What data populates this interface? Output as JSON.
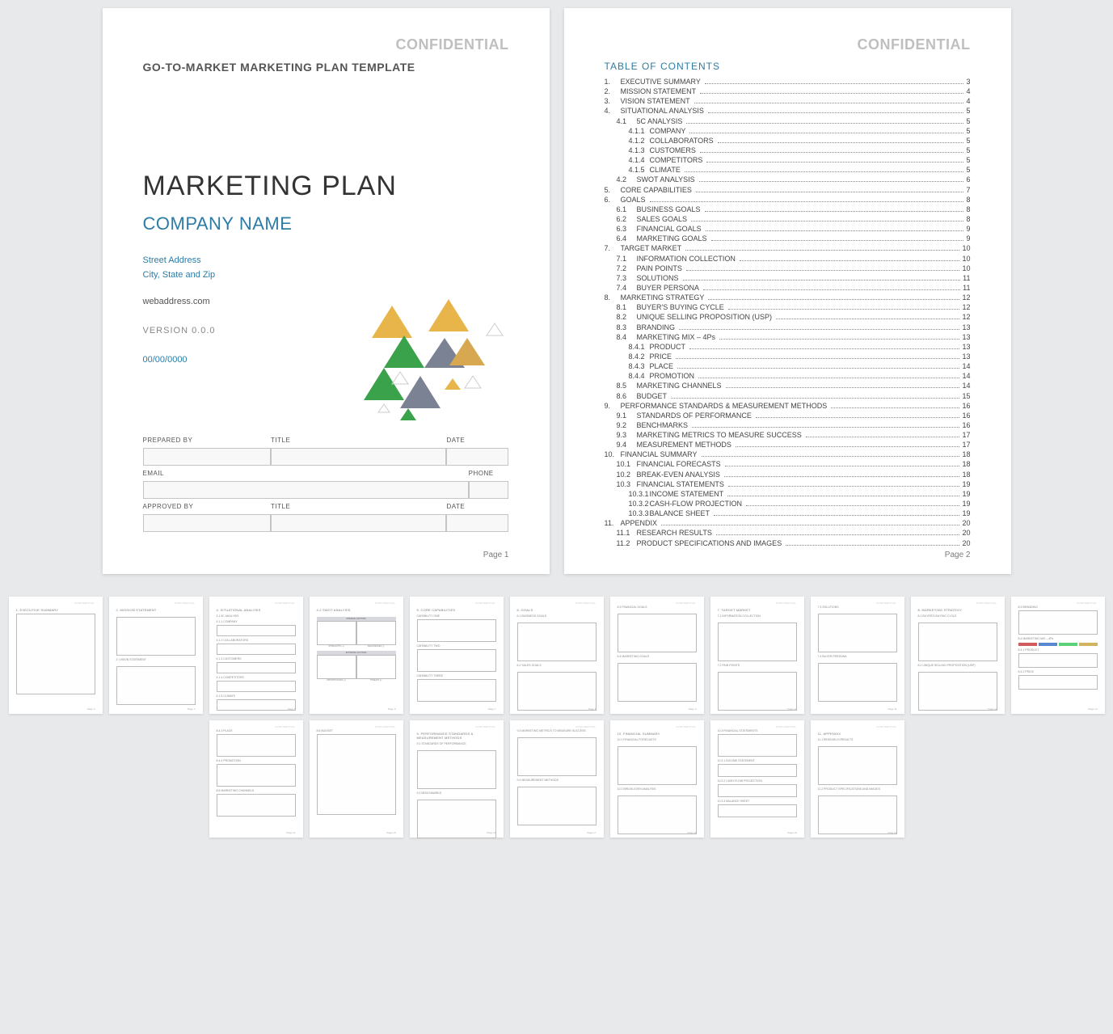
{
  "confidential": "CONFIDENTIAL",
  "cover": {
    "template_header": "GO-TO-MARKET MARKETING PLAN TEMPLATE",
    "title": "MARKETING PLAN",
    "company": "COMPANY NAME",
    "street": "Street Address",
    "citystate": "City, State and Zip",
    "web": "webaddress.com",
    "version": "VERSION 0.0.0",
    "date": "00/00/0000",
    "labels": {
      "prepared_by": "PREPARED BY",
      "title": "TITLE",
      "date": "DATE",
      "email": "EMAIL",
      "phone": "PHONE",
      "approved_by": "APPROVED BY"
    },
    "pgnum": "Page 1"
  },
  "toc": {
    "title": "TABLE OF CONTENTS",
    "pgnum": "Page 2",
    "items": [
      {
        "n": "1.",
        "t": "EXECUTIVE SUMMARY",
        "p": "3",
        "i": 1
      },
      {
        "n": "2.",
        "t": "MISSION STATEMENT",
        "p": "4",
        "i": 1
      },
      {
        "n": "3.",
        "t": "VISION STATEMENT",
        "p": "4",
        "i": 1
      },
      {
        "n": "4.",
        "t": "SITUATIONAL ANALYSIS",
        "p": "5",
        "i": 1
      },
      {
        "n": "4.1",
        "t": "5C ANALYSIS",
        "p": "5",
        "i": 2
      },
      {
        "n": "4.1.1",
        "t": "COMPANY",
        "p": "5",
        "i": 3
      },
      {
        "n": "4.1.2",
        "t": "COLLABORATORS",
        "p": "5",
        "i": 3
      },
      {
        "n": "4.1.3",
        "t": "CUSTOMERS",
        "p": "5",
        "i": 3
      },
      {
        "n": "4.1.4",
        "t": "COMPETITORS",
        "p": "5",
        "i": 3
      },
      {
        "n": "4.1.5",
        "t": "CLIMATE",
        "p": "5",
        "i": 3
      },
      {
        "n": "4.2",
        "t": "SWOT ANALYSIS",
        "p": "6",
        "i": 2
      },
      {
        "n": "5.",
        "t": "CORE CAPABILITIES",
        "p": "7",
        "i": 1
      },
      {
        "n": "6.",
        "t": "GOALS",
        "p": "8",
        "i": 1
      },
      {
        "n": "6.1",
        "t": "BUSINESS GOALS",
        "p": "8",
        "i": 2
      },
      {
        "n": "6.2",
        "t": "SALES GOALS",
        "p": "8",
        "i": 2
      },
      {
        "n": "6.3",
        "t": "FINANCIAL GOALS",
        "p": "9",
        "i": 2
      },
      {
        "n": "6.4",
        "t": "MARKETING GOALS",
        "p": "9",
        "i": 2
      },
      {
        "n": "7.",
        "t": "TARGET MARKET",
        "p": "10",
        "i": 1
      },
      {
        "n": "7.1",
        "t": "INFORMATION COLLECTION",
        "p": "10",
        "i": 2
      },
      {
        "n": "7.2",
        "t": "PAIN POINTS",
        "p": "10",
        "i": 2
      },
      {
        "n": "7.3",
        "t": "SOLUTIONS",
        "p": "11",
        "i": 2
      },
      {
        "n": "7.4",
        "t": "BUYER PERSONA",
        "p": "11",
        "i": 2
      },
      {
        "n": "8.",
        "t": "MARKETING STRATEGY",
        "p": "12",
        "i": 1
      },
      {
        "n": "8.1",
        "t": "BUYER'S BUYING CYCLE",
        "p": "12",
        "i": 2
      },
      {
        "n": "8.2",
        "t": "UNIQUE SELLING PROPOSITION (USP)",
        "p": "12",
        "i": 2
      },
      {
        "n": "8.3",
        "t": "BRANDING",
        "p": "13",
        "i": 2
      },
      {
        "n": "8.4",
        "t": "MARKETING MIX – 4Ps",
        "p": "13",
        "i": 2
      },
      {
        "n": "8.4.1",
        "t": "PRODUCT",
        "p": "13",
        "i": 3
      },
      {
        "n": "8.4.2",
        "t": "PRICE",
        "p": "13",
        "i": 3
      },
      {
        "n": "8.4.3",
        "t": "PLACE",
        "p": "14",
        "i": 3
      },
      {
        "n": "8.4.4",
        "t": "PROMOTION",
        "p": "14",
        "i": 3
      },
      {
        "n": "8.5",
        "t": "MARKETING CHANNELS",
        "p": "14",
        "i": 2
      },
      {
        "n": "8.6",
        "t": "BUDGET",
        "p": "15",
        "i": 2
      },
      {
        "n": "9.",
        "t": "PERFORMANCE STANDARDS & MEASUREMENT METHODS",
        "p": "16",
        "i": 1
      },
      {
        "n": "9.1",
        "t": "STANDARDS OF PERFORMANCE",
        "p": "16",
        "i": 2
      },
      {
        "n": "9.2",
        "t": "BENCHMARKS",
        "p": "16",
        "i": 2
      },
      {
        "n": "9.3",
        "t": "MARKETING METRICS TO MEASURE SUCCESS",
        "p": "17",
        "i": 2
      },
      {
        "n": "9.4",
        "t": "MEASUREMENT METHODS",
        "p": "17",
        "i": 2
      },
      {
        "n": "10.",
        "t": "FINANCIAL SUMMARY",
        "p": "18",
        "i": 1
      },
      {
        "n": "10.1",
        "t": "FINANCIAL FORECASTS",
        "p": "18",
        "i": 2
      },
      {
        "n": "10.2",
        "t": "BREAK-EVEN ANALYSIS",
        "p": "18",
        "i": 2
      },
      {
        "n": "10.3",
        "t": "FINANCIAL STATEMENTS",
        "p": "19",
        "i": 2
      },
      {
        "n": "10.3.1",
        "t": "INCOME STATEMENT",
        "p": "19",
        "i": 3
      },
      {
        "n": "10.3.2",
        "t": "CASH-FLOW PROJECTION",
        "p": "19",
        "i": 3
      },
      {
        "n": "10.3.3",
        "t": "BALANCE SHEET",
        "p": "19",
        "i": 3
      },
      {
        "n": "11.",
        "t": "APPENDIX",
        "p": "20",
        "i": 1
      },
      {
        "n": "11.1",
        "t": "RESEARCH RESULTS",
        "p": "20",
        "i": 2
      },
      {
        "n": "11.2",
        "t": "PRODUCT SPECIFICATIONS AND IMAGES",
        "p": "20",
        "i": 2
      }
    ]
  },
  "thumbs": [
    {
      "pg": "Page 3",
      "title": "1. EXECUTIVE SUMMARY",
      "layout": "onebig"
    },
    {
      "pg": "Page 4",
      "title": "2. MISSION STATEMENT",
      "sub2": "3. VISION STATEMENT",
      "layout": "twohalf"
    },
    {
      "pg": "Page 5",
      "title": "4. SITUATIONAL ANALYSIS",
      "sub": "4.1 5C ANALYSIS",
      "layout": "fivesmall",
      "labels": [
        "4.1.1 COMPANY",
        "4.1.2 COLLABORATORS",
        "4.1.3 CUSTOMERS",
        "4.1.4 COMPETITORS",
        "4.1.5 CLIMATE"
      ]
    },
    {
      "pg": "Page 6",
      "title": "4.2 SWOT ANALYSIS",
      "layout": "swot",
      "hdr1": "INTERNAL FACTORS",
      "cells1": [
        "STRENGTHS (+)",
        "WEAKNESSES (-)"
      ],
      "hdr2": "EXTERNAL FACTORS",
      "cells2": [
        "OPPORTUNITIES (+)",
        "THREATS (-)"
      ]
    },
    {
      "pg": "Page 7",
      "title": "5. CORE CAPABILITIES",
      "layout": "threesmall",
      "labels": [
        "CAPABILITY ONE",
        "CAPABILITY TWO",
        "CAPABILITY THREE"
      ]
    },
    {
      "pg": "Page 8",
      "title": "6. GOALS",
      "layout": "twohalf",
      "sub": "6.1 BUSINESS GOALS",
      "sub2": "6.2 SALES GOALS"
    },
    {
      "pg": "Page 9",
      "title": "",
      "layout": "twohalf",
      "sub": "6.3 FINANCIAL GOALS",
      "sub2": "6.4 MARKETING GOALS"
    },
    {
      "pg": "Page 10",
      "title": "7. TARGET MARKET",
      "layout": "twohalf",
      "sub": "7.1 INFORMATION COLLECTION",
      "sub2": "7.2 PAIN POINTS"
    },
    {
      "pg": "Page 11",
      "title": "",
      "layout": "twohalf",
      "sub": "7.3 SOLUTIONS",
      "sub2": "7.4 BUYER PERSONA"
    },
    {
      "pg": "Page 12",
      "title": "8. MARKETING STRATEGY",
      "layout": "twohalf",
      "sub": "8.1 BUYER'S BUYING CYCLE",
      "sub2": "8.2 UNIQUE SELLING PROPOSITION (USP)"
    },
    {
      "pg": "Page 13",
      "title": "",
      "layout": "brand-mix",
      "sub": "8.3 BRANDING",
      "sub2": "8.4 MARKETING MIX – 4Ps",
      "labels": [
        "8.4.1 PRODUCT",
        "8.4.2 PRICE"
      ]
    },
    {
      "pg": "Page 14",
      "title": "",
      "layout": "threesmall",
      "labels": [
        "8.4.3 PLACE",
        "8.4.4 PROMOTION",
        "8.5 MARKETING CHANNELS"
      ]
    },
    {
      "pg": "Page 15",
      "title": "",
      "layout": "onebig",
      "sub": "8.6 BUDGET"
    },
    {
      "pg": "Page 16",
      "title": "9. PERFORMANCE STANDARDS & MEASUREMENT METHODS",
      "layout": "twohalf",
      "sub": "9.1 STANDARDS OF PERFORMANCE",
      "sub2": "9.2 BENCHMARKS"
    },
    {
      "pg": "Page 17",
      "title": "",
      "layout": "twohalf",
      "sub": "9.3 MARKETING METRICS TO MEASURE SUCCESS",
      "sub2": "9.4 MEASUREMENT METHODS"
    },
    {
      "pg": "Page 18",
      "title": "10. FINANCIAL SUMMARY",
      "layout": "twohalf",
      "sub": "10.1 FINANCIAL FORECASTS",
      "sub2": "10.2 BREAK-EVEN ANALYSIS"
    },
    {
      "pg": "Page 19",
      "title": "",
      "layout": "fin-stmt",
      "sub": "10.3 FINANCIAL STATEMENTS",
      "labels": [
        "10.3.1 INCOME STATEMENT",
        "10.3.2 CASH-FLOW PROJECTION",
        "10.3.3 BALANCE SHEET"
      ]
    },
    {
      "pg": "Page 20",
      "title": "11. APPENDIX",
      "layout": "twohalf",
      "sub": "11.1 RESEARCH RESULTS",
      "sub2": "11.2 PRODUCT SPECIFICATIONS AND IMAGES"
    }
  ]
}
